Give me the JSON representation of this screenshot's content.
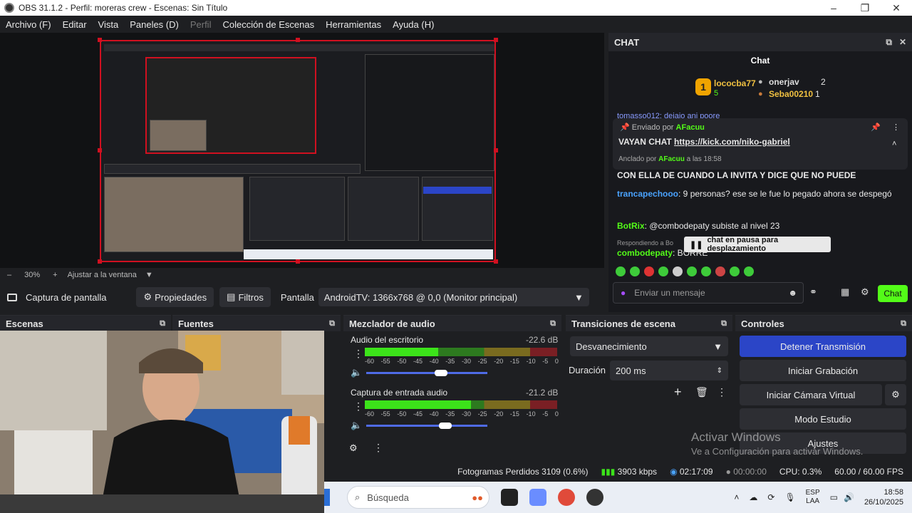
{
  "window": {
    "title": "OBS 31.1.2 - Perfil: moreras crew - Escenas: Sin Título",
    "controls": [
      "–",
      "❐",
      "✕"
    ]
  },
  "menu": [
    "Archivo (F)",
    "Editar",
    "Vista",
    "Paneles (D)",
    "Perfil",
    "Colección de Escenas",
    "Herramientas",
    "Ayuda (H)"
  ],
  "zoom": {
    "minus": "–",
    "value": "30%",
    "plus": "+",
    "fit": "Ajustar a la ventana"
  },
  "source_toolbar": {
    "source_name": "Captura de pantalla",
    "properties": "Propiedades",
    "filters": "Filtros",
    "display_label": "Pantalla",
    "display_value": "AndroidTV: 1366x768 @ 0,0 (Monitor principal)"
  },
  "chat": {
    "dock_title": "CHAT",
    "header": "Chat",
    "leaderboard": [
      {
        "rank": "1",
        "name": "lococba77",
        "count": "5"
      },
      {
        "rank": "",
        "name": "onerjav",
        "count": "2"
      },
      {
        "rank": "",
        "name": "Seba00210",
        "count": "1"
      }
    ],
    "cut_line": "tomasso012: dejaio ani poore",
    "pinned_by_prefix": "Enviado por",
    "pinned_user": "AFacuu",
    "pinned_message": "VAYAN CHAT",
    "pinned_link": "https://kick.com/niko-gabriel",
    "anchored_prefix": "Anclado por",
    "anchored_user": "AFacuu",
    "anchored_time": "a las 18:58",
    "messages": [
      {
        "user": "",
        "text": "CON ELLA DE CUANDO LA INVITA Y DICE QUE NO PUEDE"
      },
      {
        "user": "trancapechooo",
        "text": ": 9 personas? ese se le fue lo pegado ahora se despegó"
      },
      {
        "user": "BotRix",
        "text": ": @combodepaty subiste al nivel 23"
      },
      {
        "user": "combodepaty",
        "text": ": BORRE"
      }
    ],
    "replying": "Respondiendo a Bo",
    "pause_tooltip": "chat en pausa para desplazamiento",
    "input_placeholder": "Enviar un mensaje",
    "send": "Chat"
  },
  "docks": {
    "scenes": "Escenas",
    "sources": "Fuentes",
    "mixer": "Mezclador de audio",
    "transitions": "Transiciones de escena",
    "controls": "Controles"
  },
  "mixer": {
    "channels": [
      {
        "name": "Audio del escritorio",
        "db": "-22.6 dB",
        "level": 0.38,
        "volume": 0.62
      },
      {
        "name": "Captura de entrada audio",
        "db": "-21.2 dB",
        "level": 0.55,
        "volume": 0.65
      }
    ],
    "scale": [
      "-60",
      "-55",
      "-50",
      "-45",
      "-40",
      "-35",
      "-30",
      "-25",
      "-20",
      "-15",
      "-10",
      "-5",
      "0"
    ]
  },
  "transitions": {
    "type": "Desvanecimiento",
    "duration_label": "Duración",
    "duration_value": "200 ms"
  },
  "controls": {
    "stop_stream": "Detener Transmisión",
    "start_recording": "Iniciar Grabación",
    "virtual_cam": "Iniciar Cámara Virtual",
    "studio_mode": "Modo Estudio",
    "settings": "Ajustes"
  },
  "status": {
    "dropped": "Fotogramas Perdidos 3109 (0.6%)",
    "bitrate": "3903 kbps",
    "stream_time": "02:17:09",
    "rec_time": "00:00:00",
    "cpu": "CPU: 0.3%",
    "fps": "60.00 / 60.00 FPS"
  },
  "watermark": {
    "line1": "Activar Windows",
    "line2": "Ve a Configuración para activar Windows."
  },
  "taskbar": {
    "search": "Búsqueda",
    "lang1": "ESP",
    "lang2": "LAA",
    "time": "18:58",
    "date": "26/10/2025"
  },
  "colors": {
    "kick_green": "#53fc18",
    "obs_red": "#d01020",
    "primary_blue": "#2b45c7"
  }
}
